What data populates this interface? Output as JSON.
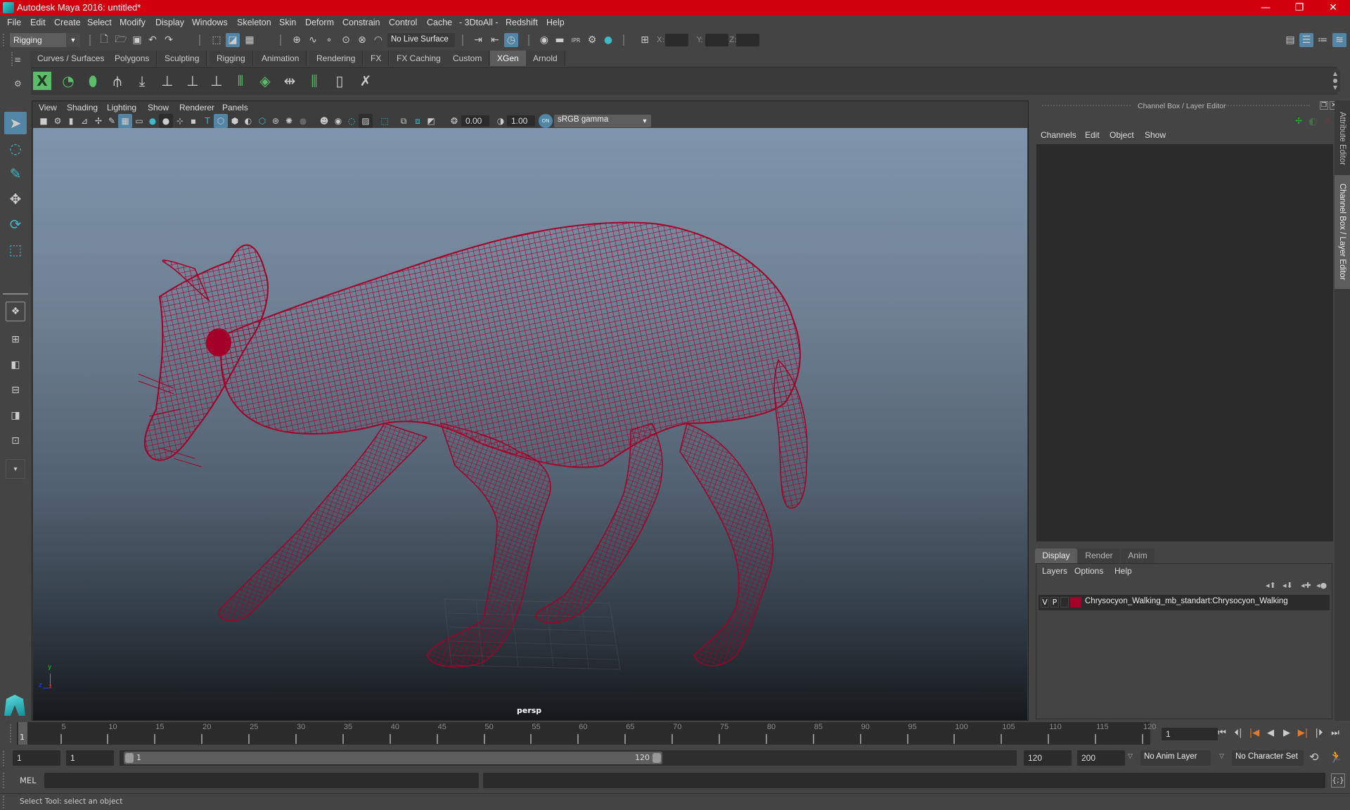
{
  "window": {
    "title": "Autodesk Maya 2016: untitled*",
    "controls": {
      "minimize": "—",
      "maximize": "❐",
      "close": "✕"
    }
  },
  "menubar": {
    "items": [
      "File",
      "Edit",
      "Create",
      "Select",
      "Modify",
      "Display",
      "Windows",
      "Skeleton",
      "Skin",
      "Deform",
      "Constrain",
      "Control",
      "Cache",
      "- 3DtoAll -",
      "Redshift",
      "Help"
    ]
  },
  "statusline": {
    "menuset": "Rigging",
    "live_surface": "No Live Surface",
    "x_label": "X:",
    "y_label": "Y:",
    "z_label": "Z:",
    "x_value": "",
    "y_value": "",
    "z_value": ""
  },
  "shelf": {
    "tabs": [
      "Curves / Surfaces",
      "Polygons",
      "Sculpting",
      "Rigging",
      "Animation",
      "Rendering",
      "FX",
      "FX Caching",
      "Custom",
      "XGen",
      "Arnold"
    ],
    "active_tab": "XGen",
    "icons": [
      "xgen-editor-icon",
      "xgen-preview-icon",
      "create-description-icon",
      "add-guides-icon",
      "sculpt-guides-icon",
      "add-guide-icon",
      "select-guide-icon",
      "lock-guide-icon",
      "guide-spline-icon",
      "collection-icon",
      "flip-guides-icon",
      "interactive-groom-icon",
      "groom-bounds-icon",
      "delete-guides-icon"
    ]
  },
  "viewport": {
    "menu": [
      "View",
      "Shading",
      "Lighting",
      "Show",
      "Renderer",
      "Panels"
    ],
    "exposure": "0.00",
    "gamma": "1.00",
    "color_mgmt": "ON",
    "colorspace": "sRGB gamma",
    "camera_label": "persp",
    "axis": {
      "x": "x",
      "y": "y",
      "z": "z"
    },
    "mesh_color": "#a3002a",
    "background_top": "#7f95ac",
    "background_bottom": "#16191c"
  },
  "channel_box": {
    "title": "Channel Box / Layer Editor",
    "menu": [
      "Channels",
      "Edit",
      "Object",
      "Show"
    ]
  },
  "layer_editor": {
    "tabs": [
      "Display",
      "Render",
      "Anim"
    ],
    "active_tab": "Display",
    "menu": [
      "Layers",
      "Options",
      "Help"
    ],
    "layers": [
      {
        "v": "V",
        "p": "P",
        "color": "#a3002a",
        "name": "Chrysocyon_Walking_mb_standart:Chrysocyon_Walking"
      }
    ]
  },
  "side_tabs": [
    "Attribute Editor",
    "Channel Box / Layer Editor"
  ],
  "timeline": {
    "start": 1,
    "end": 120,
    "current_frame_marker": "1",
    "ticks": [
      5,
      10,
      15,
      20,
      25,
      30,
      35,
      40,
      45,
      50,
      55,
      60,
      65,
      70,
      75,
      80,
      85,
      90,
      95,
      100,
      105,
      110,
      115,
      120
    ],
    "current_frame": "1"
  },
  "range": {
    "start_time": "1",
    "playback_start": "1",
    "slider_min": "1",
    "slider_max": "120",
    "playback_end": "120",
    "end_time": "200",
    "anim_layer": "No Anim Layer",
    "character_set": "No Character Set"
  },
  "command_line": {
    "language": "MEL",
    "input": "",
    "result": ""
  },
  "help_line": {
    "text": "Select Tool: select an object"
  }
}
